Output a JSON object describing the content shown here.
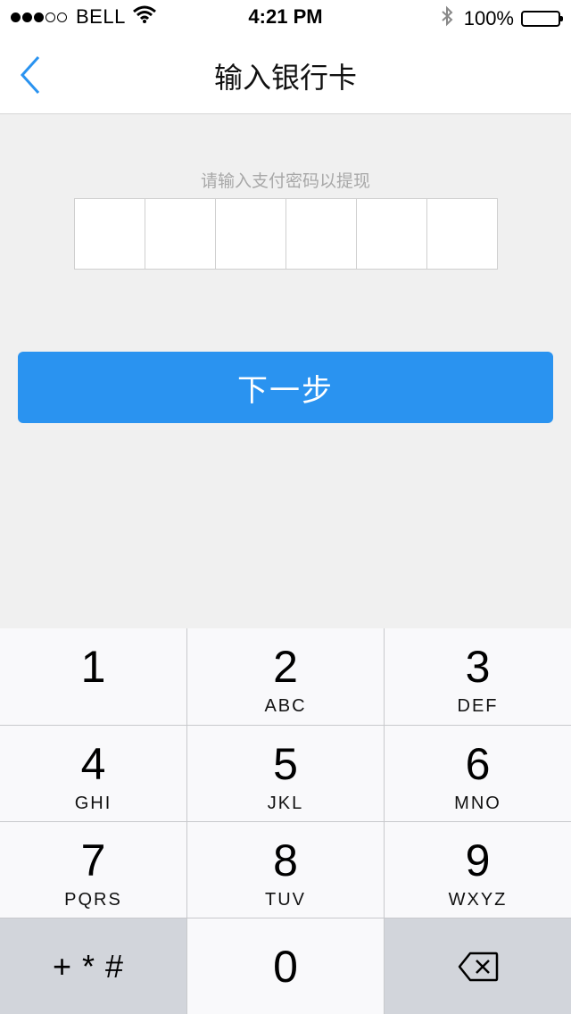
{
  "status_bar": {
    "carrier": "BELL",
    "time": "4:21 PM",
    "battery": "100%",
    "signal_dots_filled": 3,
    "signal_dots_total": 5
  },
  "nav": {
    "title": "输入银行卡",
    "back_icon": "chevron-left-icon"
  },
  "prompt": "请输入支付密码以提现",
  "password_cells": 6,
  "next_button": "下一步",
  "keypad": {
    "keys": [
      {
        "num": "1",
        "letters": ""
      },
      {
        "num": "2",
        "letters": "ABC"
      },
      {
        "num": "3",
        "letters": "DEF"
      },
      {
        "num": "4",
        "letters": "GHI"
      },
      {
        "num": "5",
        "letters": "JKL"
      },
      {
        "num": "6",
        "letters": "MNO"
      },
      {
        "num": "7",
        "letters": "PQRS"
      },
      {
        "num": "8",
        "letters": "TUV"
      },
      {
        "num": "9",
        "letters": "WXYZ"
      }
    ],
    "symbols": "+*#",
    "zero": "0",
    "delete_icon": "backspace-icon"
  },
  "colors": {
    "accent": "#2a93f0",
    "background": "#f0f0f0"
  }
}
